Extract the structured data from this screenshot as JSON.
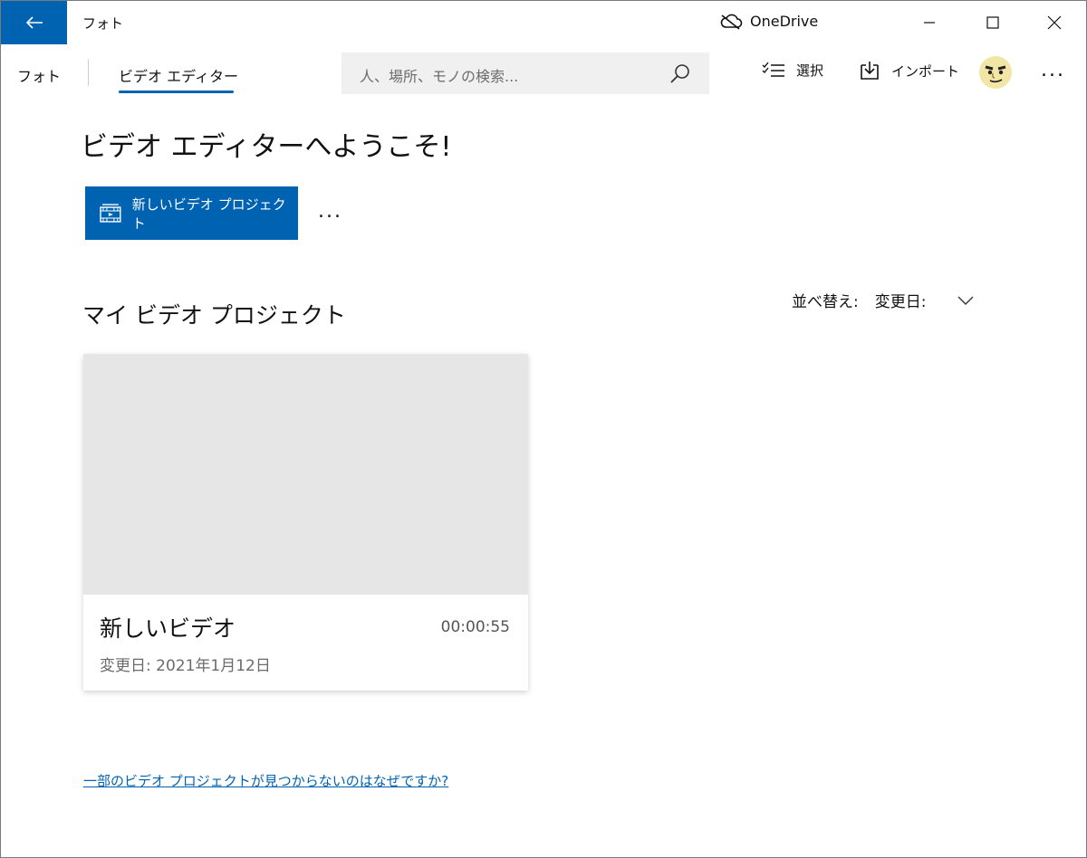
{
  "titlebar": {
    "app_title": "フォト",
    "onedrive_label": "OneDrive"
  },
  "nav": {
    "photos_label": "フォト",
    "video_editor_tab": "ビデオ エディター",
    "search_placeholder": "人、場所、モノの検索...",
    "select_label": "選択",
    "import_label": "インポート",
    "more_label": "..."
  },
  "main": {
    "welcome": "ビデオ エディターへようこそ!",
    "new_project_label": "新しいビデオ プロジェクト",
    "more_label": "...",
    "section_title": "マイ ビデオ プロジェクト",
    "sort_label": "並べ替え:",
    "sort_value": "変更日:"
  },
  "projects": [
    {
      "title": "新しいビデオ",
      "duration": "00:00:55",
      "modified": "変更日: 2021年1月12日"
    }
  ],
  "help_link": "一部のビデオ プロジェクトが見つからないのはなぜですか?",
  "colors": {
    "accent": "#0063b1",
    "thumbnail": "#e6e6e6"
  }
}
